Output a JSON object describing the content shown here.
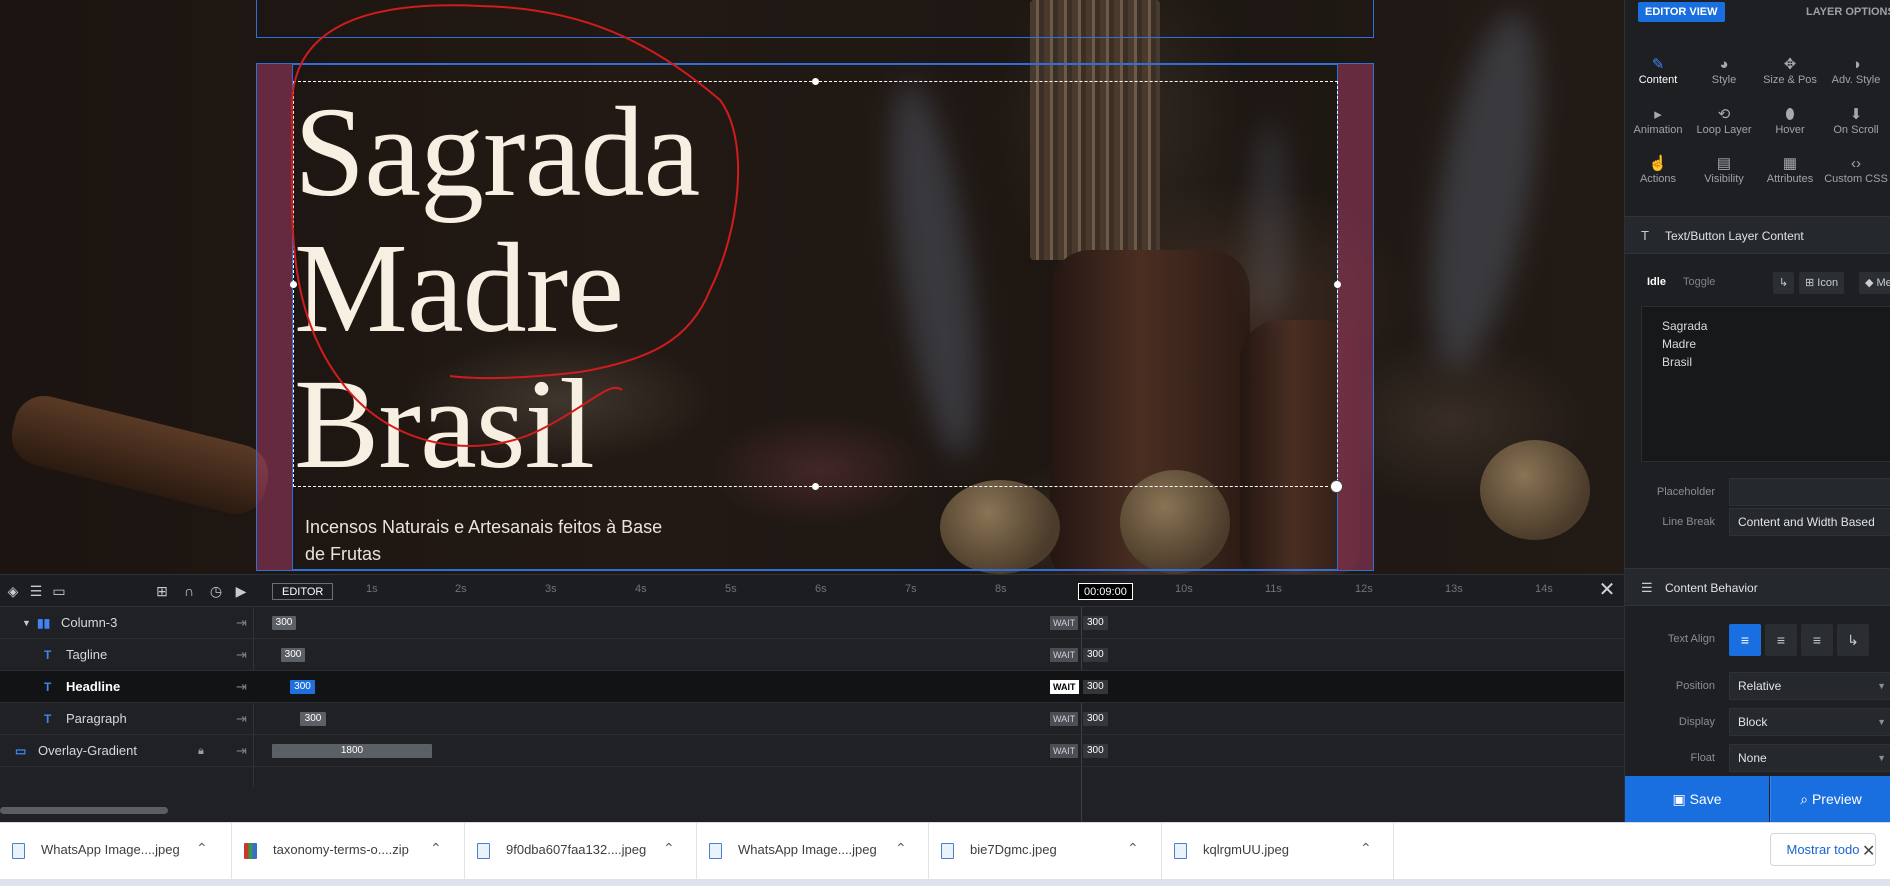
{
  "canvas": {
    "headline_lines": [
      "Sagrada",
      "Madre",
      "Brasil"
    ],
    "tagline": "Incensos Naturais e Artesanais feitos à Base de Frutas"
  },
  "timeline": {
    "editor_tag": "EDITOR",
    "current_time": "00:09:00",
    "ruler": [
      "1s",
      "2s",
      "3s",
      "4s",
      "5s",
      "6s",
      "7s",
      "8s",
      "10s",
      "11s",
      "12s",
      "13s",
      "14s"
    ],
    "wait_label": "WAIT",
    "rows": [
      {
        "name": "Column-3",
        "bar": "300",
        "wait_value": "300"
      },
      {
        "name": "Tagline",
        "bar": "300",
        "wait_value": "300"
      },
      {
        "name": "Headline",
        "bar": "300",
        "wait_value": "300"
      },
      {
        "name": "Paragraph",
        "bar": "300",
        "wait_value": "300"
      },
      {
        "name": "Overlay-Gradient",
        "bar": "1800",
        "wait_value": "300"
      }
    ],
    "type_glyph": "T"
  },
  "panel": {
    "editor_view": "EDITOR VIEW",
    "layer_options": "LAYER OPTIONS",
    "options": [
      {
        "label": "Content",
        "icon": "pen-icon"
      },
      {
        "label": "Style",
        "icon": "palette-icon"
      },
      {
        "label": "Size & Pos",
        "icon": "move-icon"
      },
      {
        "label": "Adv. Style",
        "icon": "contrast-icon"
      },
      {
        "label": "Animation",
        "icon": "play-icon"
      },
      {
        "label": "Loop Layer",
        "icon": "loop-icon"
      },
      {
        "label": "Hover",
        "icon": "mouse-icon"
      },
      {
        "label": "On Scroll",
        "icon": "scroll-icon"
      },
      {
        "label": "Actions",
        "icon": "pointer-icon"
      },
      {
        "label": "Visibility",
        "icon": "visibility-icon"
      },
      {
        "label": "Attributes",
        "icon": "document-icon"
      },
      {
        "label": "Custom CSS",
        "icon": "code-icon"
      }
    ],
    "section_content": "Text/Button Layer Content",
    "idle": "Idle",
    "toggle": "Toggle",
    "icon_btn": "Icon",
    "meta_btn": "Meta",
    "content_lines": [
      "Sagrada",
      "Madre",
      "Brasil"
    ],
    "placeholder_label": "Placeholder",
    "placeholder_value": "",
    "line_break_label": "Line Break",
    "line_break_value": "Content and Width Based",
    "section_behavior": "Content Behavior",
    "text_align_label": "Text Align",
    "position_label": "Position",
    "position_value": "Relative",
    "display_label": "Display",
    "display_value": "Block",
    "float_label": "Float",
    "float_value": "None",
    "save": "Save",
    "preview": "Preview"
  },
  "downloads": {
    "files": [
      {
        "name": "WhatsApp Image....jpeg",
        "type": "image"
      },
      {
        "name": "taxonomy-terms-o....zip",
        "type": "zip"
      },
      {
        "name": "9f0dba607faa132....jpeg",
        "type": "image"
      },
      {
        "name": "WhatsApp Image....jpeg",
        "type": "image"
      },
      {
        "name": "bie7Dgmc.jpeg",
        "type": "image"
      },
      {
        "name": "kqlrgmUU.jpeg",
        "type": "image"
      }
    ],
    "show_all": "Mostrar todo"
  }
}
